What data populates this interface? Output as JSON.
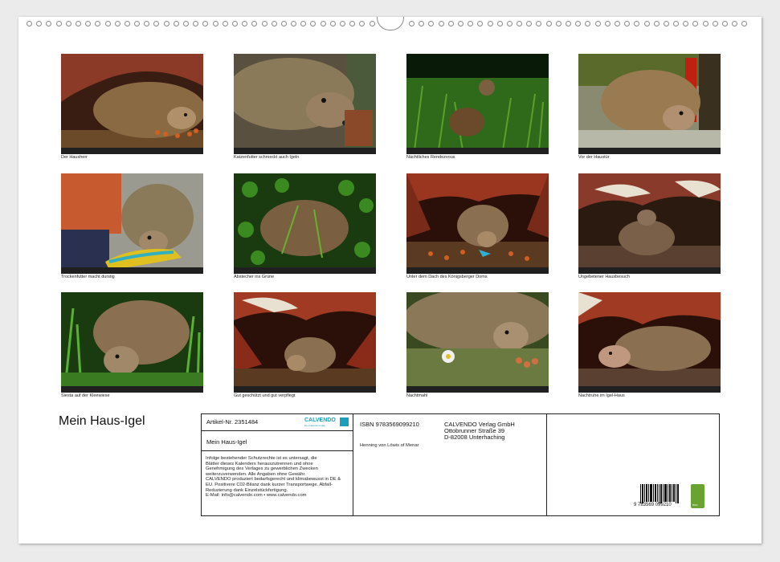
{
  "calendar": {
    "title": "Mein Haus-Igel",
    "photos": [
      {
        "caption": "Der Hausherr"
      },
      {
        "caption": "Katzenfutter schmeckt auch Igeln"
      },
      {
        "caption": "Nächtliches Rendezvous"
      },
      {
        "caption": "Vor der Haustür"
      },
      {
        "caption": "Trockenfutter macht durstig"
      },
      {
        "caption": "Abstecher ins Grüne"
      },
      {
        "caption": "Unter dem Dach des Königsberger Doms"
      },
      {
        "caption": "Ungebetener Hausbesuch"
      },
      {
        "caption": "Siesta auf der Kleewiese"
      },
      {
        "caption": "Gut geschützt und gut verpflegt"
      },
      {
        "caption": "Nachtmahl"
      },
      {
        "caption": "Nachtruhe im Igel-Haus"
      }
    ]
  },
  "info": {
    "article": "Artikel-Nr. 2351484",
    "logo": "CALVENDO",
    "logo_sub": "Der Kalenderverlag",
    "product_title": "Mein Haus-Igel",
    "legal_lines": [
      "Infolge bestehender Schutzrechte ist es untersagt, die",
      "Blätter dieses Kalenders herauszutrennen und ohne",
      "Genehmigung des Verlages zu gewerblichen Zwecken",
      "weiterzuverwenden. Alle Angaben ohne Gewähr.",
      "CALVENDO produziert bedarfsgerecht und klimabewusst in DE &",
      "EU. Positivere C02-Bilanz dank kurzer Transportwege. Abfall-",
      "Reduzierung dank Einzelstückfertigung.",
      "E-Mail: info@calvendo.com • www.calvendo.com"
    ],
    "isbn": "ISBN 9783569099210",
    "author": "Henning von Löwis of Menar",
    "publisher_lines": [
      "CALVENDO Verlag GmbH",
      "Ottobrunner Straße 39",
      "D-82008 Unterhaching"
    ],
    "barcode_number": "9 783569 099210",
    "eco_label": "eco"
  },
  "colors": {
    "frame": "#222222",
    "accent": "#1aa0b8",
    "eco": "#6aa332"
  }
}
